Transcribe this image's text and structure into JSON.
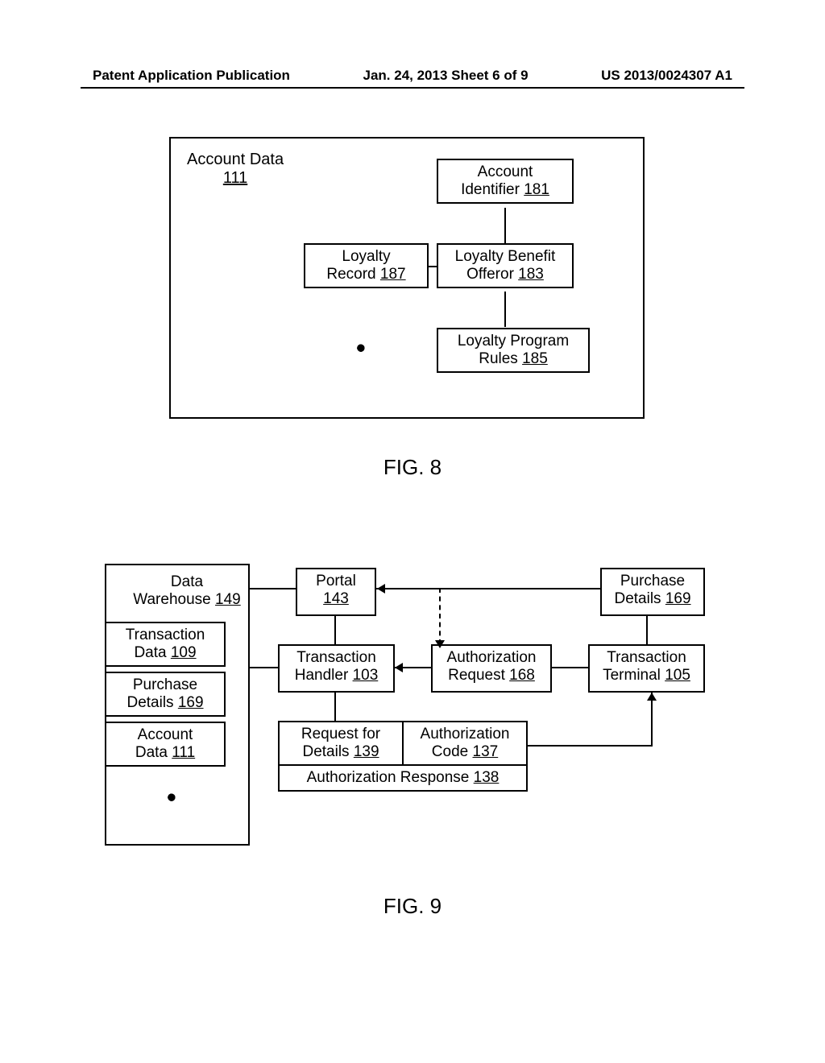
{
  "header": {
    "left": "Patent Application Publication",
    "center": "Jan. 24, 2013  Sheet 6 of 9",
    "right": "US 2013/0024307 A1"
  },
  "fig8": {
    "title": "Account Data",
    "title_ref": "111",
    "account_identifier": "Account Identifier",
    "account_identifier_ref": "181",
    "loyalty_record": "Loyalty Record",
    "loyalty_record_ref": "187",
    "loyalty_benefit": "Loyalty Benefit Offeror",
    "loyalty_benefit_ref": "183",
    "loyalty_rules": "Loyalty Program Rules",
    "loyalty_rules_ref": "185",
    "caption": "FIG. 8"
  },
  "fig9": {
    "data_warehouse": "Data Warehouse",
    "data_warehouse_ref": "149",
    "transaction_data": "Transaction Data",
    "transaction_data_ref": "109",
    "purchase_details_dw": "Purchase Details",
    "purchase_details_dw_ref": "169",
    "account_data": "Account Data",
    "account_data_ref": "111",
    "portal": "Portal",
    "portal_ref": "143",
    "transaction_handler": "Transaction Handler",
    "transaction_handler_ref": "103",
    "authorization_request": "Authorization Request",
    "authorization_request_ref": "168",
    "transaction_terminal": "Transaction Terminal",
    "transaction_terminal_ref": "105",
    "purchase_details": "Purchase Details",
    "purchase_details_ref": "169",
    "request_for_details": "Request for Details",
    "request_for_details_ref": "139",
    "authorization_code": "Authorization Code",
    "authorization_code_ref": "137",
    "authorization_response": "Authorization Response",
    "authorization_response_ref": "138",
    "caption": "FIG. 9"
  }
}
